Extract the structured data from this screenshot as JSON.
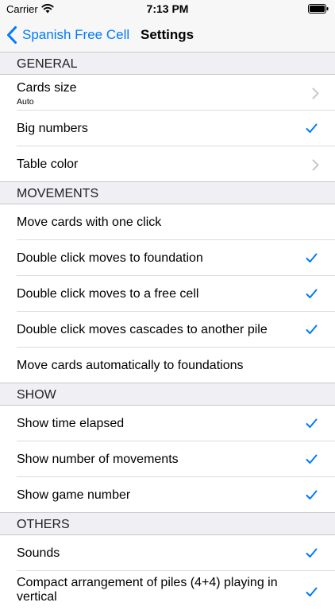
{
  "status_bar": {
    "carrier": "Carrier",
    "time": "7:13 PM"
  },
  "nav": {
    "back_label": "Spanish Free Cell",
    "title": "Settings"
  },
  "colors": {
    "accent": "#007aff",
    "background": "#efeff4",
    "row": "#ffffff"
  },
  "sections": {
    "general": {
      "header": "GENERAL",
      "items": [
        {
          "label": "Cards size",
          "sublabel": "Auto",
          "accessory": "chevron"
        },
        {
          "label": "Big numbers",
          "accessory": "checkmark"
        },
        {
          "label": "Table color",
          "accessory": "chevron"
        }
      ]
    },
    "movements": {
      "header": "MOVEMENTS",
      "items": [
        {
          "label": "Move cards with one click",
          "accessory": "none"
        },
        {
          "label": "Double click moves to foundation",
          "accessory": "checkmark"
        },
        {
          "label": "Double click moves to a free cell",
          "accessory": "checkmark"
        },
        {
          "label": "Double click moves cascades to another pile",
          "accessory": "checkmark"
        },
        {
          "label": "Move cards automatically to foundations",
          "accessory": "none"
        }
      ]
    },
    "show": {
      "header": "SHOW",
      "items": [
        {
          "label": "Show time elapsed",
          "accessory": "checkmark"
        },
        {
          "label": "Show number of movements",
          "accessory": "checkmark"
        },
        {
          "label": "Show game number",
          "accessory": "checkmark"
        }
      ]
    },
    "others": {
      "header": "OTHERS",
      "items": [
        {
          "label": "Sounds",
          "accessory": "checkmark"
        },
        {
          "label": "Compact arrangement of piles (4+4) playing in vertical",
          "accessory": "checkmark"
        }
      ]
    }
  }
}
